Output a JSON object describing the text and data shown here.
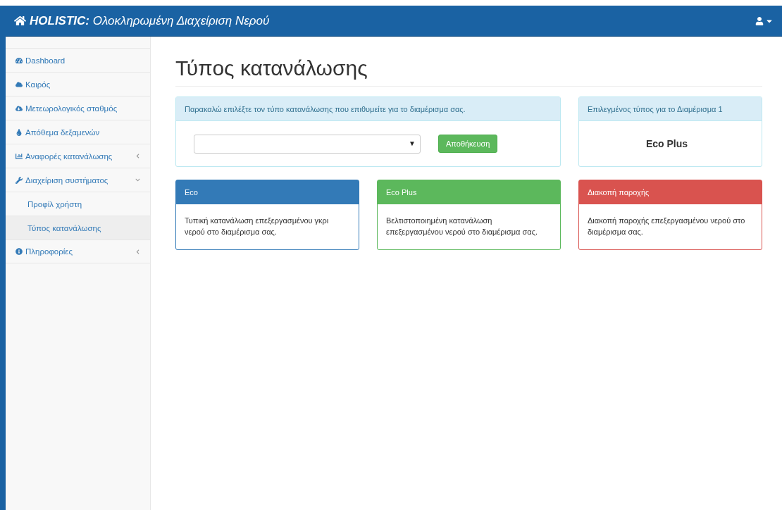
{
  "header": {
    "brand": "HOLISTIC:",
    "title": "Ολοκληρωμένη Διαχείριση Νερού"
  },
  "sidebar": {
    "items": [
      {
        "label": "Dashboard"
      },
      {
        "label": "Καιρός"
      },
      {
        "label": "Μετεωρολογικός σταθμός"
      },
      {
        "label": "Απόθεμα δεξαμενών"
      },
      {
        "label": "Αναφορές κατανάλωσης",
        "expanded": false
      },
      {
        "label": "Διαχείριση συστήματος",
        "expanded": true,
        "children": [
          {
            "label": "Προφίλ χρήστη",
            "selected": false
          },
          {
            "label": "Τύπος κατανάλωσης",
            "selected": true
          }
        ]
      },
      {
        "label": "Πληροφορίες",
        "expanded": false
      }
    ]
  },
  "page_title": "Τύπος κατανάλωσης",
  "select_panel": {
    "heading": "Παρακαλώ επιλέξτε τον τύπο κατανάλωσης που επιθυμείτε για το διαμέρισμα σας.",
    "dropdown_arrow": "▼",
    "button": "Αποθήκευση"
  },
  "current_panel": {
    "heading": "Επιλεγμένος τύπος για το Διαμέρισμα 1",
    "value": "Eco Plus"
  },
  "types": [
    {
      "title": "Eco",
      "text": "Τυπική κατανάλωση επεξεργασμένου γκρι νερού στο διαμέρισμα σας.",
      "color": "#337ab7"
    },
    {
      "title": "Eco Plus",
      "text": "Βελτιστοποιημένη κατανάλωση επεξεργασμένου νερού στο διαμέρισμα σας.",
      "color": "#5cb85c"
    },
    {
      "title": "Διακοπή παροχής",
      "text": "Διακοπή παροχής επεξεργασμένου νερού στο διαμέρισμα σας.",
      "color": "#d9534f"
    }
  ]
}
